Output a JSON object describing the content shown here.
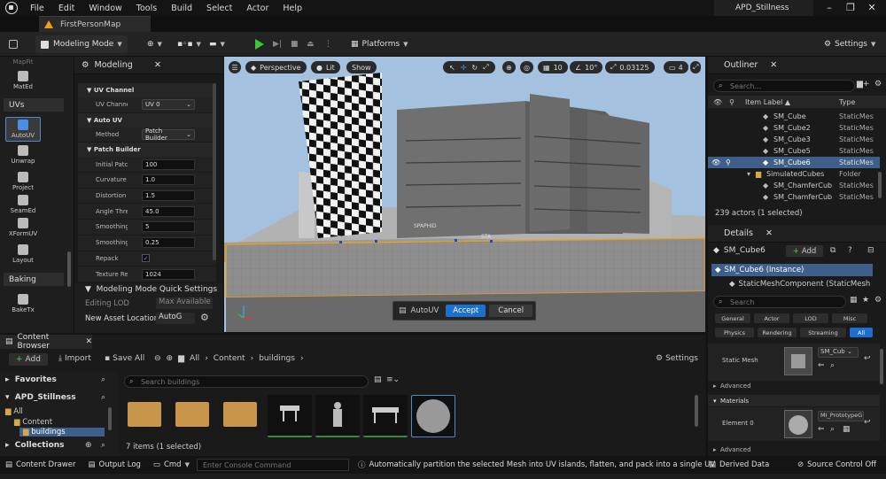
{
  "menu": {
    "items": [
      "File",
      "Edit",
      "Window",
      "Tools",
      "Build",
      "Select",
      "Actor",
      "Help"
    ],
    "project": "APD_Stillness"
  },
  "tab": {
    "map": "FirstPersonMap"
  },
  "toolbar": {
    "mode": "Modeling Mode",
    "platforms": "Platforms",
    "settings": "Settings"
  },
  "left_tools": {
    "top": "MapFit",
    "mated": "MatEd",
    "uvs": "UVs",
    "tools": [
      "AutoUV",
      "Unwrap",
      "Project",
      "SeamEd",
      "XFormUV",
      "Layout"
    ],
    "baking": "Baking",
    "baketx": "BakeTx"
  },
  "modeling": {
    "title": "Modeling",
    "uv_channel_section": "UV Channel",
    "uv_channel_label": "UV Channel",
    "uv_channel_value": "UV 0",
    "auto_uv_section": "Auto UV",
    "method_label": "Method",
    "method_value": "Patch Builder",
    "patch_section": "Patch Builder",
    "rows": [
      {
        "label": "Initial Patches",
        "value": "100"
      },
      {
        "label": "Curvature Al...",
        "value": "1.0"
      },
      {
        "label": "Distortion T...",
        "value": "1.5"
      },
      {
        "label": "Angle Thres...",
        "value": "45.0"
      },
      {
        "label": "Smoothing S...",
        "value": "5"
      },
      {
        "label": "Smoothing A...",
        "value": "0.25"
      }
    ],
    "repack": "Repack",
    "texres_label": "Texture Res...",
    "texres_value": "1024",
    "quick": "Modeling Mode Quick Settings",
    "lod_label": "Editing LOD",
    "lod_value": "Max Available",
    "asset_label": "New Asset Location",
    "asset_value": "AutoG"
  },
  "viewport": {
    "perspective": "Perspective",
    "lit": "Lit",
    "show": "Show",
    "grid": "10",
    "angle": "10°",
    "scale": "0.03125",
    "cam": "4",
    "autouv": "AutoUV",
    "accept": "Accept",
    "cancel": "Cancel",
    "signs": [
      "SPAPHID",
      "STA"
    ]
  },
  "outliner": {
    "title": "Outliner",
    "search": "Search...",
    "col_label": "Item Label ▲",
    "col_type": "Type",
    "rows": [
      {
        "name": "SM_Cube",
        "type": "StaticMes"
      },
      {
        "name": "SM_Cube2",
        "type": "StaticMes"
      },
      {
        "name": "SM_Cube3",
        "type": "StaticMes"
      },
      {
        "name": "SM_Cube5",
        "type": "StaticMes"
      },
      {
        "name": "SM_Cube6",
        "type": "StaticMes"
      },
      {
        "name": "SimulatedCubes",
        "type": "Folder"
      },
      {
        "name": "SM_ChamferCub",
        "type": "StaticMes"
      },
      {
        "name": "SM_ChamferCub",
        "type": "StaticMes"
      }
    ],
    "count": "239 actors (1 selected)"
  },
  "details": {
    "title": "Details",
    "object": "SM_Cube6",
    "add": "Add",
    "instance": "SM_Cube6 (Instance)",
    "component": "StaticMeshComponent (StaticMesh",
    "search": "Search",
    "filters": [
      "General",
      "Actor",
      "LOD",
      "Misc",
      "Physics",
      "Rendering",
      "Streaming",
      "All"
    ],
    "static_mesh_label": "Static Mesh",
    "static_mesh_value": "SM_Cub",
    "advanced": "Advanced",
    "materials": "Materials",
    "element0": "Element 0",
    "material_value": "MI_PrototypeG",
    "advanced2": "Advanced"
  },
  "content_browser": {
    "title": "Content Browser",
    "add": "Add",
    "import": "Import",
    "saveall": "Save All",
    "path": [
      "All",
      "Content",
      "buildings"
    ],
    "settings": "Settings",
    "favorites": "Favorites",
    "project": "APD_Stillness",
    "tree": [
      "All",
      "Content",
      "buildings"
    ],
    "collections": "Collections",
    "search": "Search buildings",
    "count": "7 items (1 selected)"
  },
  "status": {
    "drawer": "Content Drawer",
    "output": "Output Log",
    "cmd": "Cmd",
    "console": "Enter Console Command",
    "hint": "Automatically partition the selected Mesh into UV islands, flatten, and pack into a single UV",
    "derived": "Derived Data",
    "source": "Source Control Off"
  }
}
